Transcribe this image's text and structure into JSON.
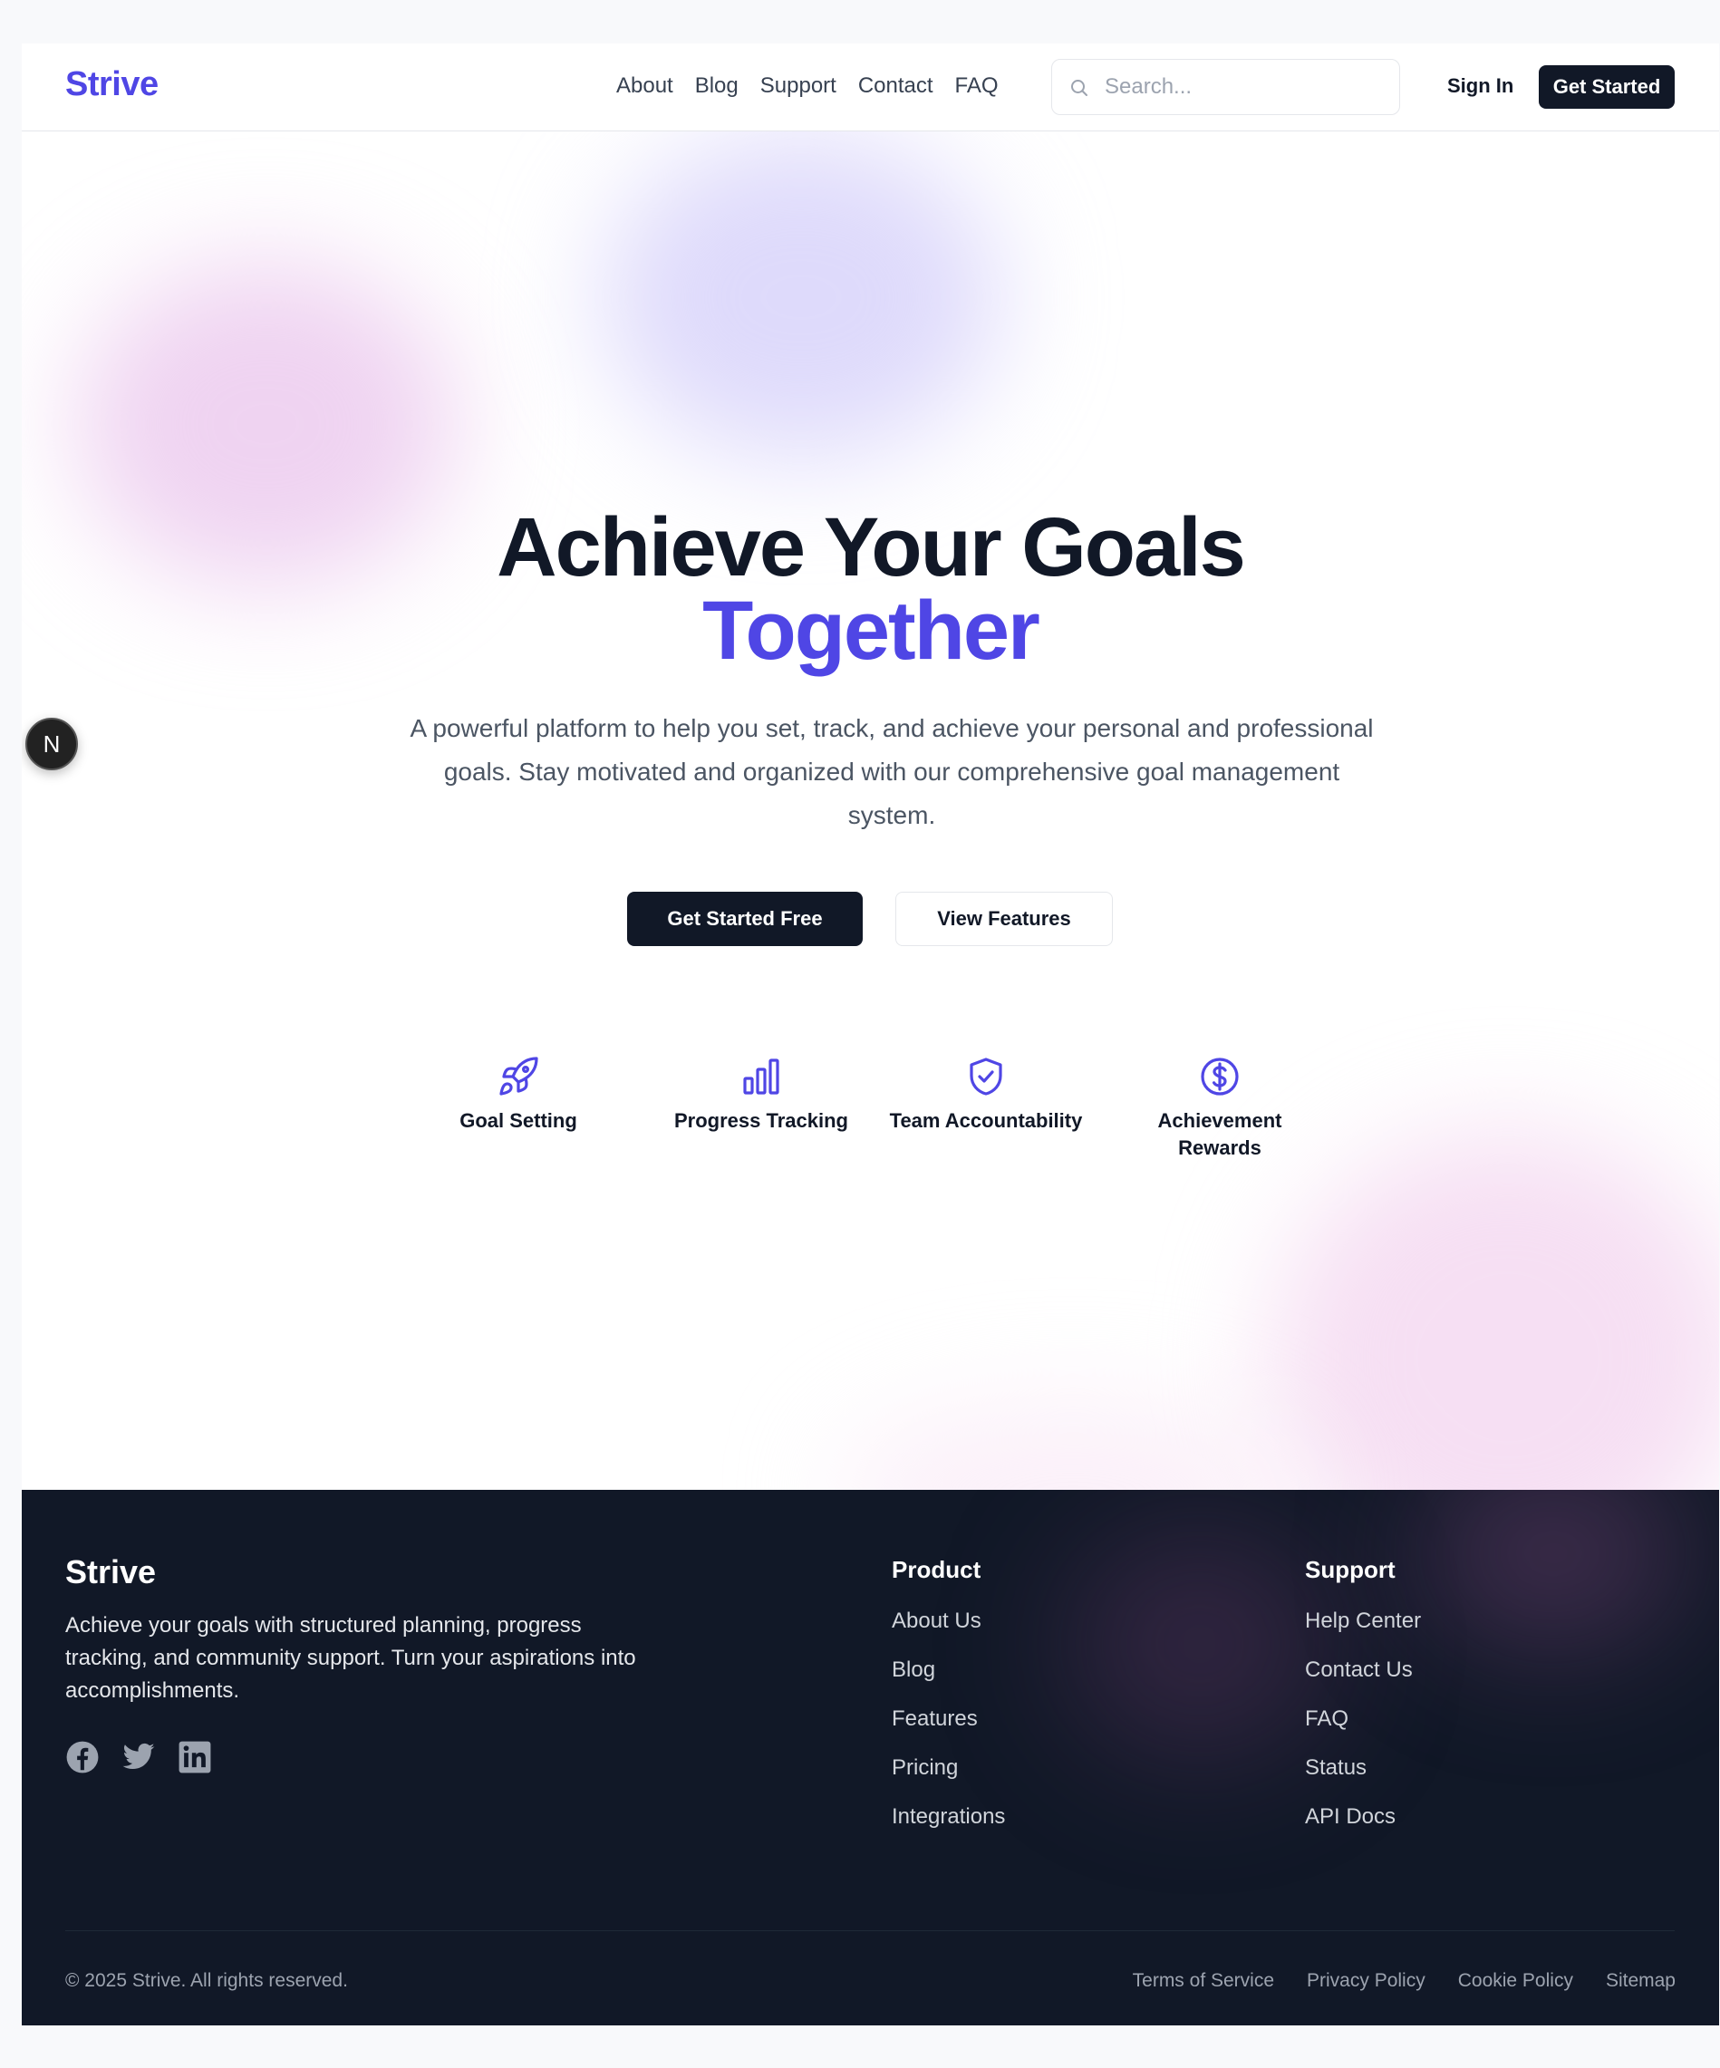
{
  "header": {
    "logo": "Strive",
    "nav": [
      "About",
      "Blog",
      "Support",
      "Contact",
      "FAQ"
    ],
    "search_placeholder": "Search...",
    "sign_in": "Sign In",
    "get_started": "Get Started"
  },
  "hero": {
    "title_line1": "Achieve Your Goals",
    "title_line2": "Together",
    "subtitle": "A powerful platform to help you set, track, and achieve your personal and professional goals. Stay motivated and organized with our comprehensive goal management system.",
    "primary_cta": "Get Started Free",
    "secondary_cta": "View Features",
    "features": [
      {
        "label": "Goal Setting",
        "icon": "rocket-icon"
      },
      {
        "label": "Progress Tracking",
        "icon": "bar-chart-icon"
      },
      {
        "label": "Team Accountability",
        "icon": "shield-check-icon"
      },
      {
        "label": "Achievement Rewards",
        "icon": "dollar-circle-icon"
      }
    ]
  },
  "dev_badge": "N",
  "footer": {
    "logo": "Strive",
    "description": "Achieve your goals with structured planning, progress tracking, and community support. Turn your aspirations into accomplishments.",
    "social": [
      "facebook-icon",
      "twitter-icon",
      "linkedin-icon"
    ],
    "columns": [
      {
        "title": "Product",
        "links": [
          "About Us",
          "Blog",
          "Features",
          "Pricing",
          "Integrations"
        ]
      },
      {
        "title": "Support",
        "links": [
          "Help Center",
          "Contact Us",
          "FAQ",
          "Status",
          "API Docs"
        ]
      }
    ],
    "copyright": "© 2025 Strive. All rights reserved.",
    "legal": [
      "Terms of Service",
      "Privacy Policy",
      "Cookie Policy",
      "Sitemap"
    ]
  },
  "colors": {
    "brand": "#4f46e5",
    "dark": "#111827",
    "footer_bg": "#111827"
  }
}
